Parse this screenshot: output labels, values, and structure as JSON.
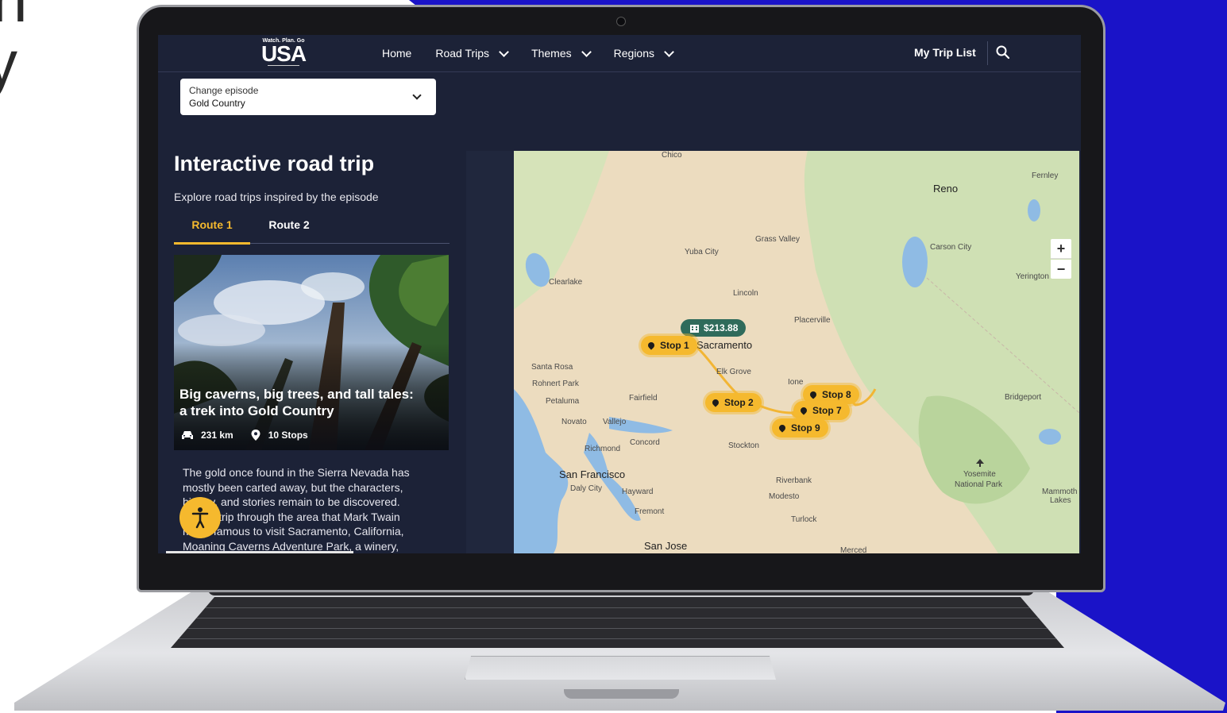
{
  "background": {
    "text_lines": [
      "n",
      "y"
    ],
    "accent_color": "#1a13c8"
  },
  "nav": {
    "logo_tagline": "Watch. Plan. Go",
    "logo_text": "USA",
    "items": [
      {
        "label": "Home",
        "has_dropdown": false
      },
      {
        "label": "Road Trips",
        "has_dropdown": true
      },
      {
        "label": "Themes",
        "has_dropdown": true
      },
      {
        "label": "Regions",
        "has_dropdown": true
      }
    ],
    "my_trip_list": "My Trip List",
    "search_icon": "search-icon"
  },
  "episode_select": {
    "label": "Change episode",
    "value": "Gold Country"
  },
  "panel": {
    "title": "Interactive road trip",
    "subtitle": "Explore road trips inspired by the episode",
    "tabs": [
      {
        "label": "Route 1",
        "active": true
      },
      {
        "label": "Route 2",
        "active": false
      }
    ]
  },
  "card": {
    "title_line1": "Big caverns, big trees, and tall tales:",
    "title_line2": "a trek into Gold Country",
    "distance": "231 km",
    "stops": "10 Stops"
  },
  "description": {
    "lines": [
      "The gold once found in the Sierra Nevada has",
      "mostly been carted away, but the characters,",
      "history, and stories remain to be discovered.",
      "Take a trip through the area that Mark Twain",
      "made famous to visit Sacramento, California,",
      "Moaning Caverns Adventure Park, a winery,"
    ]
  },
  "map": {
    "price": "$213.88",
    "stops": [
      "Stop 1",
      "Stop 2",
      "Stop 7",
      "Stop 8",
      "Stop 9"
    ],
    "places": {
      "chico": "Chico",
      "fernley": "Fernley",
      "reno": "Reno",
      "grass_valley": "Grass Valley",
      "yuba_city": "Yuba City",
      "carson_city": "Carson City",
      "clearlake": "Clearlake",
      "yerington": "Yerington",
      "lincoln": "Lincoln",
      "placerville": "Placerville",
      "sacramento": "Sacramento",
      "santa_rosa": "Santa Rosa",
      "elk_grove": "Elk Grove",
      "rohnert_park": "Rohnert Park",
      "ione": "Ione",
      "petaluma": "Petaluma",
      "fairfield": "Fairfield",
      "bridgeport": "Bridgeport",
      "novato": "Novato",
      "vallejo": "Vallejo",
      "concord": "Concord",
      "stockton": "Stockton",
      "richmond": "Richmond",
      "san_francisco": "San Francisco",
      "yosemite_1": "Yosemite",
      "yosemite_2": "National Park",
      "daly_city": "Daly City",
      "hayward": "Hayward",
      "riverbank": "Riverbank",
      "mammoth_1": "Mammoth",
      "mammoth_2": "Lakes",
      "modesto": "Modesto",
      "fremont": "Fremont",
      "turlock": "Turlock",
      "san_jose": "San Jose",
      "merced": "Merced"
    },
    "zoom_in": "+",
    "zoom_out": "−"
  },
  "colors": {
    "page_bg": "#1c2237",
    "accent": "#f5b92e",
    "price_badge": "#2f6b5b"
  }
}
